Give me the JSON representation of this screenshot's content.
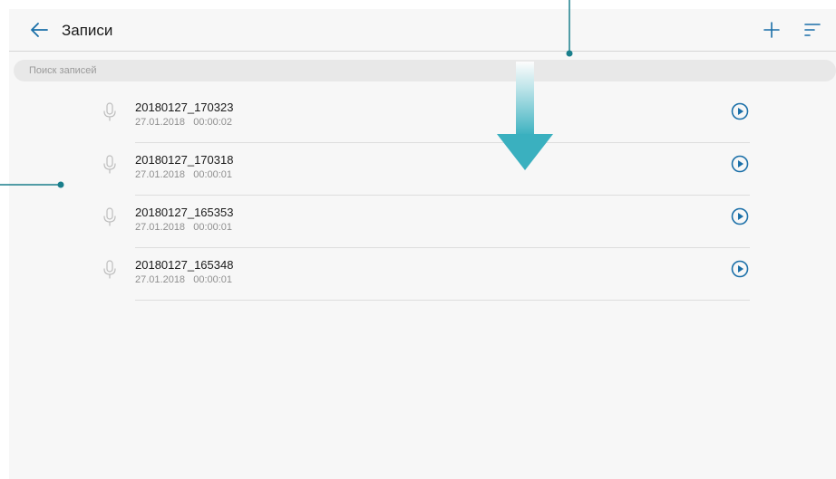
{
  "header": {
    "title": "Записи",
    "back_icon": "arrow-left-icon",
    "add_icon": "plus-icon",
    "sort_icon": "sort-icon"
  },
  "search": {
    "placeholder": "Поиск записей",
    "value": ""
  },
  "recordings": [
    {
      "name": "20180127_170323",
      "date": "27.01.2018",
      "duration": "00:00:02",
      "meta": "27.01.2018   00:00:02"
    },
    {
      "name": "20180127_170318",
      "date": "27.01.2018",
      "duration": "00:00:01",
      "meta": "27.01.2018   00:00:01"
    },
    {
      "name": "20180127_165353",
      "date": "27.01.2018",
      "duration": "00:00:01",
      "meta": "27.01.2018   00:00:01"
    },
    {
      "name": "20180127_165348",
      "date": "27.01.2018",
      "duration": "00:00:01",
      "meta": "27.01.2018   00:00:01"
    }
  ],
  "icons": {
    "recording": "microphone-icon",
    "play": "play-circle-icon",
    "swipe_hint": "swipe-down-arrow-icon"
  },
  "colors": {
    "accent": "#1a6fa8",
    "callout": "#1a7f8c",
    "arrow_top": "#ffffff",
    "arrow_bottom": "#3ab0bf",
    "background": "#f7f7f7"
  }
}
